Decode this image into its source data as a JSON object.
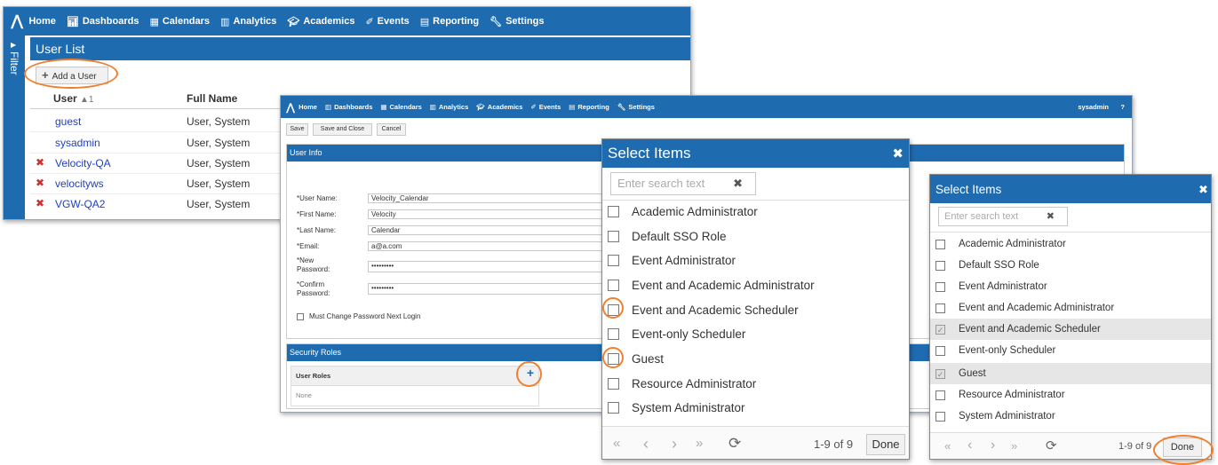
{
  "colors": {
    "nav": "#1e6bb0",
    "accent_circle": "#f08030",
    "link": "#2040c0",
    "delete": "#d03030"
  },
  "nav": {
    "logo_icon": "velocity-logo-icon",
    "items": [
      {
        "label": "Home",
        "icon": ""
      },
      {
        "label": "Dashboards",
        "icon": "bar-chart-icon"
      },
      {
        "label": "Calendars",
        "icon": "calendar-icon"
      },
      {
        "label": "Analytics",
        "icon": "bar-chart-icon"
      },
      {
        "label": "Academics",
        "icon": "graduation-cap-icon"
      },
      {
        "label": "Events",
        "icon": "ticket-icon"
      },
      {
        "label": "Reporting",
        "icon": "document-icon"
      },
      {
        "label": "Settings",
        "icon": "wrench-icon"
      }
    ],
    "user": "sysadmin",
    "help": "?"
  },
  "user_list": {
    "filter_label": "Filter",
    "title": "User List",
    "add_button": "Add a User",
    "columns": {
      "user": "User",
      "sort": "▲1",
      "full_name": "Full Name"
    },
    "rows": [
      {
        "user": "guest",
        "full_name": "User, System",
        "deletable": false
      },
      {
        "user": "sysadmin",
        "full_name": "User, System",
        "deletable": false
      },
      {
        "user": "Velocity-QA",
        "full_name": "User, System",
        "deletable": true
      },
      {
        "user": "velocityws",
        "full_name": "User, System",
        "deletable": true
      },
      {
        "user": "VGW-QA2",
        "full_name": "User, System",
        "deletable": true
      }
    ]
  },
  "edit_user": {
    "toolbar": {
      "save": "Save",
      "save_close": "Save and Close",
      "cancel": "Cancel"
    },
    "user_info_title": "User Info",
    "fields": {
      "username": {
        "label": "User Name:",
        "value": "Velocity_Calendar"
      },
      "first": {
        "label": "First Name:",
        "value": "Velocity"
      },
      "last": {
        "label": "Last Name:",
        "value": "Calendar"
      },
      "email": {
        "label": "Email:",
        "value": "a@a.com"
      },
      "new_pw": {
        "label": "New",
        "label2": "Password:",
        "value": "•••••••••"
      },
      "confirm_pw": {
        "label": "Confirm",
        "label2": "Password:",
        "value": "•••••••••"
      }
    },
    "required_mark": "*",
    "must_change": "Must Change Password Next Login",
    "security_title": "Security Roles",
    "roles_header": "User Roles",
    "roles_value": "None",
    "add_role": "+"
  },
  "select_dialog": {
    "title": "Select Items",
    "close": "✖",
    "search_placeholder": "Enter search text",
    "clear": "✖",
    "items": [
      "Academic Administrator",
      "Default SSO Role",
      "Event Administrator",
      "Event and Academic Administrator",
      "Event and Academic Scheduler",
      "Event-only Scheduler",
      "Guest",
      "Resource Administrator",
      "System Administrator"
    ],
    "pager": {
      "first": "«",
      "prev": "‹",
      "next": "›",
      "last": "»",
      "refresh": "⟳",
      "count": "1-9 of 9",
      "count_clipped": "1-9 of 9"
    },
    "done": "Done"
  },
  "select_dialog_right": {
    "checked": [
      false,
      false,
      false,
      false,
      true,
      false,
      true,
      false,
      false
    ]
  }
}
